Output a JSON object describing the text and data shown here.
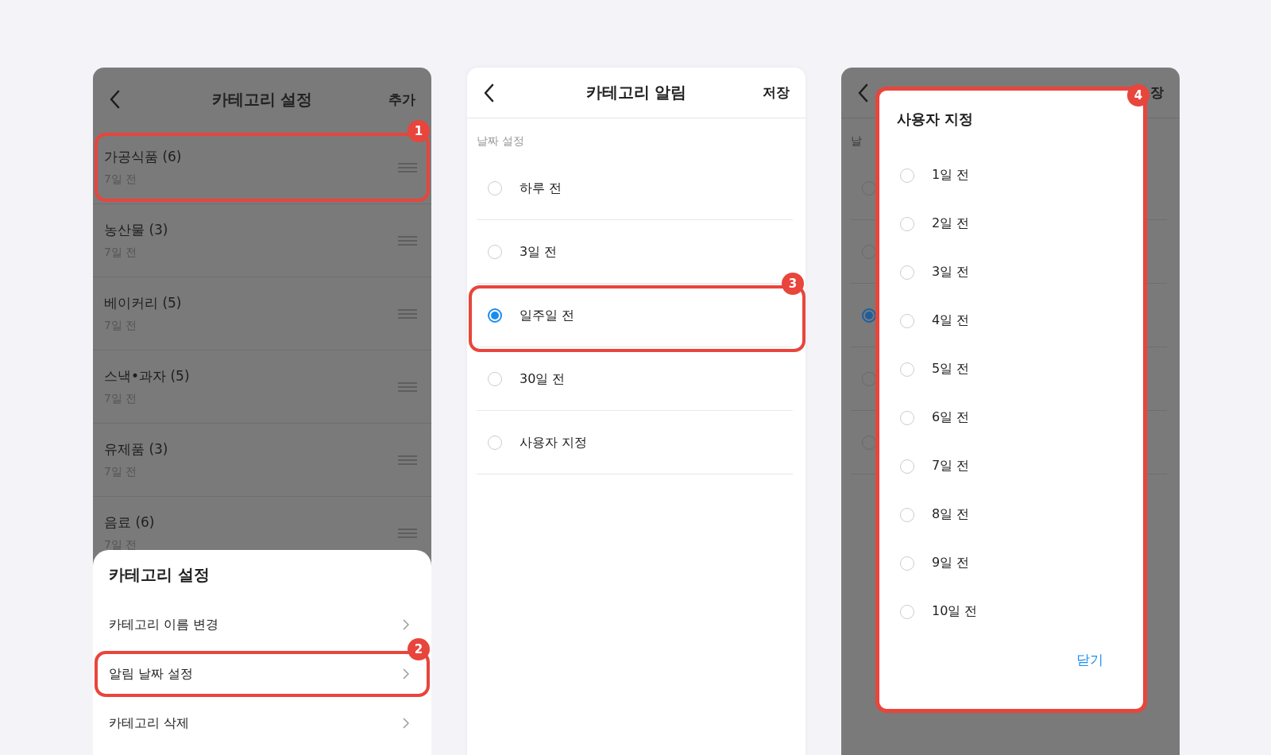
{
  "category_settings": {
    "header": {
      "title": "카테고리 설정",
      "action": "추가"
    },
    "items": [
      {
        "name": "가공식품 (6)",
        "subtitle": "7일 전",
        "callout": "1"
      },
      {
        "name": "농산물 (3)",
        "subtitle": "7일 전"
      },
      {
        "name": "베이커리 (5)",
        "subtitle": "7일 전"
      },
      {
        "name": "스낵•과자 (5)",
        "subtitle": "7일 전"
      },
      {
        "name": "유제품 (3)",
        "subtitle": "7일 전"
      },
      {
        "name": "음료 (6)",
        "subtitle": "7일 전"
      }
    ],
    "sheet": {
      "title": "카테고리 설정",
      "items": [
        {
          "label": "카테고리 이름 변경"
        },
        {
          "label": "알림 날짜 설정",
          "callout": "2"
        },
        {
          "label": "카테고리 삭제"
        }
      ]
    }
  },
  "category_alert": {
    "header": {
      "title": "카테고리 알림",
      "action": "저장"
    },
    "section_label": "날짜 설정",
    "options": [
      {
        "label": "하루 전",
        "selected": false
      },
      {
        "label": "3일 전",
        "selected": false
      },
      {
        "label": "일주일 전",
        "selected": true,
        "callout": "3"
      },
      {
        "label": "30일 전",
        "selected": false
      },
      {
        "label": "사용자 지정",
        "selected": false
      }
    ]
  },
  "custom_dialog_screen": {
    "header": {
      "action": "장"
    },
    "section_label": "날",
    "background_options": [
      {
        "selected": false
      },
      {
        "selected": false
      },
      {
        "selected": true
      },
      {
        "selected": false
      },
      {
        "selected": false
      }
    ],
    "dialog": {
      "title": "사용자 지정",
      "callout": "4",
      "options": [
        {
          "label": "1일 전",
          "selected": false
        },
        {
          "label": "2일 전",
          "selected": false
        },
        {
          "label": "3일 전",
          "selected": false
        },
        {
          "label": "4일 전",
          "selected": false
        },
        {
          "label": "5일 전",
          "selected": false
        },
        {
          "label": "6일 전",
          "selected": false
        },
        {
          "label": "7일 전",
          "selected": false
        },
        {
          "label": "8일 전",
          "selected": false
        },
        {
          "label": "9일 전",
          "selected": false
        },
        {
          "label": "10일 전",
          "selected": false
        }
      ],
      "close": "닫기"
    }
  }
}
